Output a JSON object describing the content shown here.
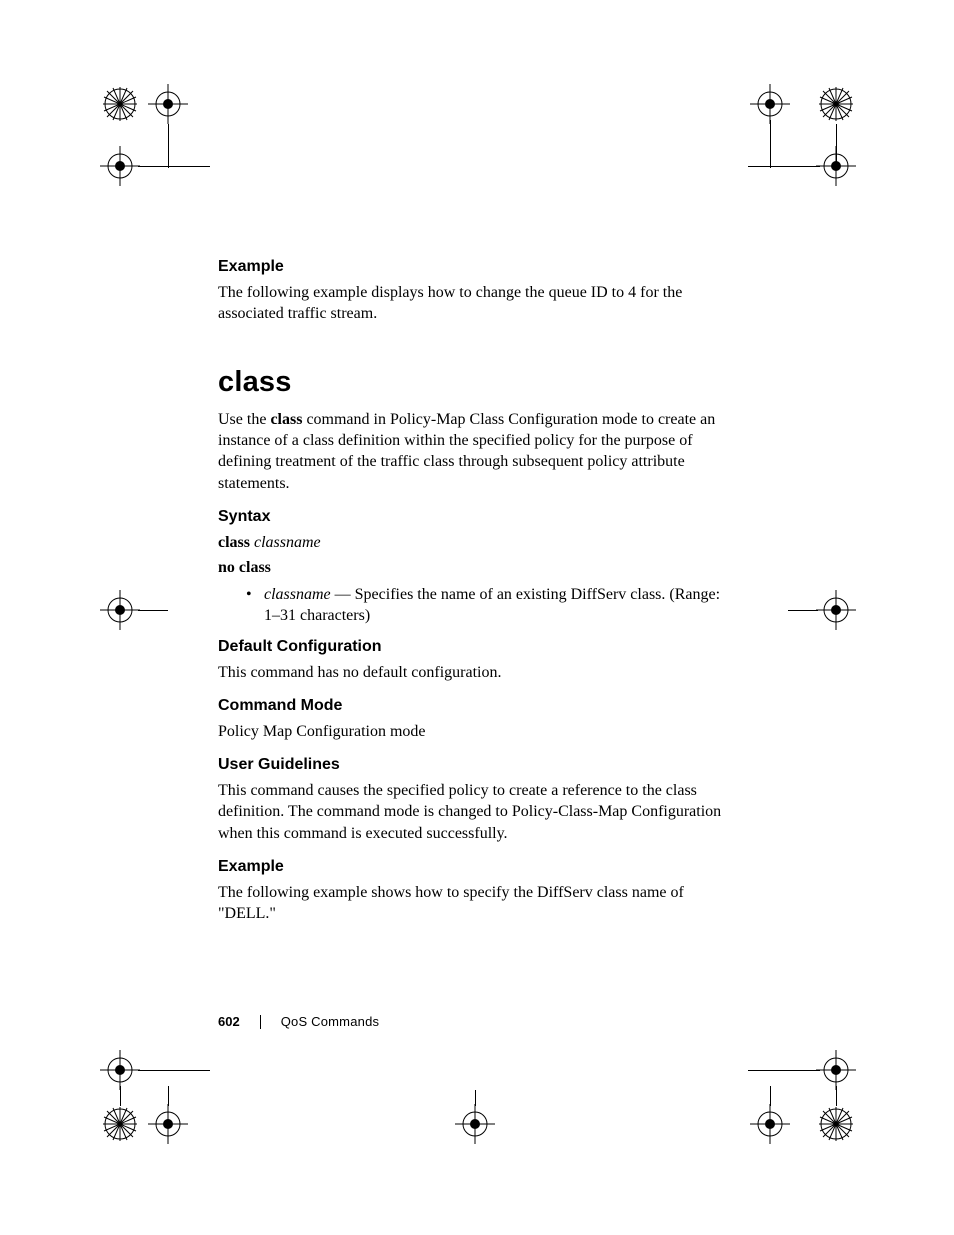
{
  "example1": {
    "heading": "Example",
    "text": "The following example displays how to change the queue ID to 4 for the associated traffic stream."
  },
  "command": {
    "title": "class",
    "intro_prefix": "Use the ",
    "intro_bold": "class",
    "intro_suffix": " command in Policy-Map Class Configuration mode to create an instance of a class definition within the specified policy for the purpose of defining treatment of the traffic class through subsequent policy attribute statements."
  },
  "syntax": {
    "heading": "Syntax",
    "line1_bold": "class ",
    "line1_italic": "classname",
    "line2_bold": "no class",
    "bullet_italic": "classname",
    "bullet_text": " — Specifies the name of an existing DiffServ class. (Range: 1–31 characters)"
  },
  "default_cfg": {
    "heading": "Default Configuration",
    "text": "This command has no default configuration."
  },
  "command_mode": {
    "heading": "Command Mode",
    "text": "Policy Map Configuration mode"
  },
  "user_guidelines": {
    "heading": "User Guidelines",
    "text": "This command causes the specified policy to create a reference to the class definition. The command mode is changed to Policy-Class-Map Configuration when this command is executed successfully."
  },
  "example2": {
    "heading": "Example",
    "text": "The following example shows how to specify the DiffServ class name of \"DELL.\""
  },
  "footer": {
    "page_number": "602",
    "section": "QoS Commands"
  }
}
